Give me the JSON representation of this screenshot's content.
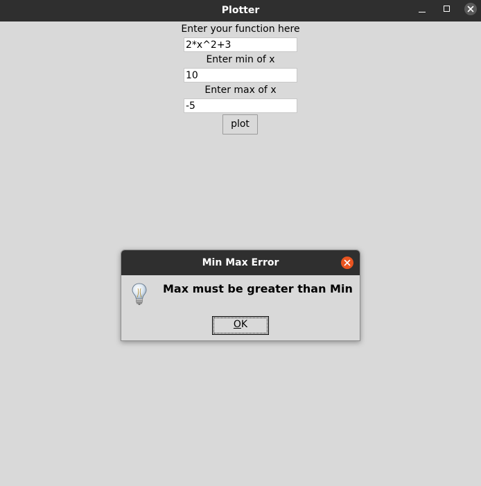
{
  "window": {
    "title": "Plotter",
    "titlebar_color": "#2f2f2f",
    "background": "#d9d9d9",
    "controls": [
      "minimize-icon",
      "maximize-icon",
      "close-icon"
    ]
  },
  "form": {
    "function_label": "Enter your function here",
    "function_value": "2*x^2+3",
    "min_label": "Enter min of x",
    "min_value": "10",
    "max_label": "Enter max of x",
    "max_value": "-5",
    "plot_button": "plot"
  },
  "dialog": {
    "title": "Min Max Error",
    "icon": "lightbulb-icon",
    "message": "Max must be greater than Min",
    "ok_label": "OK",
    "ok_underline": "O",
    "ok_rest": "K",
    "close_color": "#e95420"
  }
}
